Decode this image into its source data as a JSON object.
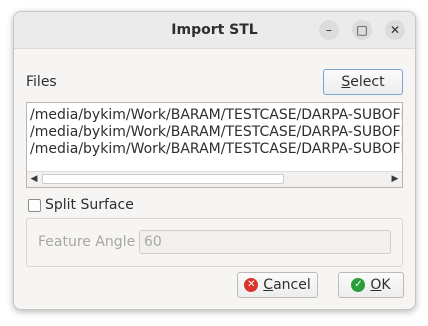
{
  "window": {
    "title": "Import STL",
    "controls": {
      "minimize": "–",
      "maximize": "□",
      "close": "✕"
    }
  },
  "files": {
    "label": "Files",
    "select_button": {
      "pre": "",
      "underlined": "S",
      "post": "elect"
    },
    "items": [
      "/media/bykim/Work/BARAM/TESTCASE/DARPA-SUBOFF",
      "/media/bykim/Work/BARAM/TESTCASE/DARPA-SUBOFF",
      "/media/bykim/Work/BARAM/TESTCASE/DARPA-SUBOFF"
    ],
    "scroll_left_icon": "◀",
    "scroll_right_icon": "▶"
  },
  "split_surface": {
    "label": "Split Surface",
    "checked": false
  },
  "feature_angle": {
    "label": "Feature Angle",
    "value": "60"
  },
  "buttons": {
    "cancel": {
      "icon": "✕",
      "underlined": "C",
      "rest": "ancel"
    },
    "ok": {
      "icon": "✓",
      "underlined": "O",
      "rest": "K"
    }
  }
}
